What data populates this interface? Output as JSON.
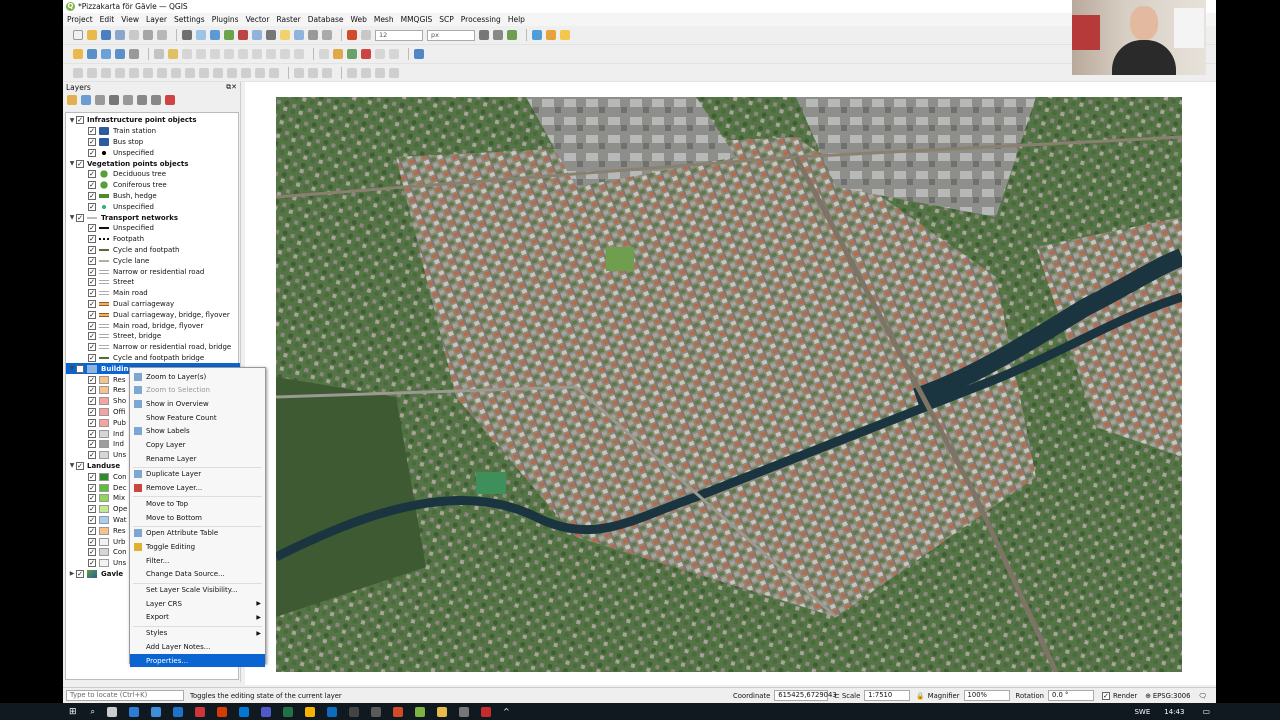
{
  "window": {
    "title": "*Pizzakarta för Gävle — QGIS"
  },
  "menubar": [
    "Project",
    "Edit",
    "View",
    "Layer",
    "Settings",
    "Plugins",
    "Vector",
    "Raster",
    "Database",
    "Web",
    "Mesh",
    "MMQGIS",
    "SCP",
    "Processing",
    "Help"
  ],
  "toolbar": {
    "font_size_value": "12",
    "unit_value": "px"
  },
  "layers_panel": {
    "title": "Layers",
    "rows": [
      {
        "level": 0,
        "expand": "▼",
        "checked": true,
        "label": "Infrastructure point objects",
        "group": true,
        "sym": "none"
      },
      {
        "level": 1,
        "checked": true,
        "label": "Train station",
        "sym": "train"
      },
      {
        "level": 1,
        "checked": true,
        "label": "Bus stop",
        "sym": "bus"
      },
      {
        "level": 1,
        "checked": true,
        "label": "Unspecified",
        "sym": "dot-black"
      },
      {
        "level": 0,
        "expand": "▼",
        "checked": true,
        "label": "Vegetation points objects",
        "group": true,
        "sym": "none"
      },
      {
        "level": 1,
        "checked": true,
        "label": "Deciduous tree",
        "sym": "tree-green"
      },
      {
        "level": 1,
        "checked": true,
        "label": "Coniferous tree",
        "sym": "tree-green"
      },
      {
        "level": 1,
        "checked": true,
        "label": "Bush, hedge",
        "sym": "bush"
      },
      {
        "level": 1,
        "checked": true,
        "label": "Unspecified",
        "sym": "dot-green"
      },
      {
        "level": 0,
        "expand": "▼",
        "checked": true,
        "label": "Transport networks",
        "group": true,
        "sym": "line-group"
      },
      {
        "level": 1,
        "checked": true,
        "label": "Unspecified",
        "sym": "line-black"
      },
      {
        "level": 1,
        "checked": true,
        "label": "Footpath",
        "sym": "line-dash"
      },
      {
        "level": 1,
        "checked": true,
        "label": "Cycle and footpath",
        "sym": "line-olive"
      },
      {
        "level": 1,
        "checked": true,
        "label": "Cycle lane",
        "sym": "line-olive-thin"
      },
      {
        "level": 1,
        "checked": true,
        "label": "Narrow or residential road",
        "sym": "line-white"
      },
      {
        "level": 1,
        "checked": true,
        "label": "Street",
        "sym": "line-white"
      },
      {
        "level": 1,
        "checked": true,
        "label": "Main road",
        "sym": "line-white"
      },
      {
        "level": 1,
        "checked": true,
        "label": "Dual carriageway",
        "sym": "line-orange"
      },
      {
        "level": 1,
        "checked": true,
        "label": "Dual carriageway, bridge, flyover",
        "sym": "line-orange"
      },
      {
        "level": 1,
        "checked": true,
        "label": "Main road, bridge, flyover",
        "sym": "line-white"
      },
      {
        "level": 1,
        "checked": true,
        "label": "Street, bridge",
        "sym": "line-white"
      },
      {
        "level": 1,
        "checked": true,
        "label": "Narrow or residential road, bridge",
        "sym": "line-white"
      },
      {
        "level": 1,
        "checked": true,
        "label": "Cycle and footpath bridge",
        "sym": "line-olive"
      },
      {
        "level": 0,
        "expand": "▼",
        "checked": true,
        "label": "Buildings",
        "group": true,
        "selected": true,
        "sym": "poly-blue"
      },
      {
        "level": 1,
        "checked": true,
        "label": "Res",
        "sym": "sq-peach"
      },
      {
        "level": 1,
        "checked": true,
        "label": "Res",
        "sym": "sq-peach"
      },
      {
        "level": 1,
        "checked": true,
        "label": "Sho",
        "sym": "sq-pink"
      },
      {
        "level": 1,
        "checked": true,
        "label": "Offi",
        "sym": "sq-pink"
      },
      {
        "level": 1,
        "checked": true,
        "label": "Pub",
        "sym": "sq-pink"
      },
      {
        "level": 1,
        "checked": true,
        "label": "Ind",
        "sym": "sq-lgray"
      },
      {
        "level": 1,
        "checked": true,
        "label": "Ind",
        "sym": "sq-gray"
      },
      {
        "level": 1,
        "checked": true,
        "label": "Uns",
        "sym": "sq-lgray"
      },
      {
        "level": 0,
        "expand": "▼",
        "checked": true,
        "label": "Landuse",
        "group": true,
        "sym": "none"
      },
      {
        "level": 1,
        "checked": true,
        "label": "Con",
        "sym": "sq-dgreen"
      },
      {
        "level": 1,
        "checked": true,
        "label": "Dec",
        "sym": "sq-green"
      },
      {
        "level": 1,
        "checked": true,
        "label": "Mix",
        "sym": "sq-lgreen"
      },
      {
        "level": 1,
        "checked": true,
        "label": "Ope",
        "sym": "sq-ygreen"
      },
      {
        "level": 1,
        "checked": true,
        "label": "Wat",
        "sym": "sq-blue"
      },
      {
        "level": 1,
        "checked": true,
        "label": "Res",
        "sym": "sq-peach"
      },
      {
        "level": 1,
        "checked": true,
        "label": "Urb",
        "sym": "sq-white"
      },
      {
        "level": 1,
        "checked": true,
        "label": "Con",
        "sym": "sq-lgray"
      },
      {
        "level": 1,
        "checked": true,
        "label": "Uns",
        "sym": "sq-white"
      },
      {
        "level": 0,
        "expand": "▶",
        "checked": true,
        "label": "Gavle",
        "group": true,
        "sym": "raster"
      }
    ]
  },
  "context_menu": {
    "items": [
      {
        "label": "Zoom to Layer(s)",
        "icon": "zoom-icon"
      },
      {
        "label": "Zoom to Selection",
        "disabled": true,
        "icon": "zoom-selection-icon"
      },
      {
        "label": "Show in Overview",
        "icon": "overview-icon"
      },
      {
        "label": "Show Feature Count"
      },
      {
        "label": "Show Labels",
        "icon": "labels-icon"
      },
      {
        "label": "Copy Layer"
      },
      {
        "label": "Rename Layer"
      },
      {
        "sep": true
      },
      {
        "label": "Duplicate Layer",
        "icon": "duplicate-icon"
      },
      {
        "label": "Remove Layer...",
        "icon": "remove-icon"
      },
      {
        "sep": true
      },
      {
        "label": "Move to Top"
      },
      {
        "label": "Move to Bottom"
      },
      {
        "sep": true
      },
      {
        "label": "Open Attribute Table",
        "icon": "table-icon"
      },
      {
        "label": "Toggle Editing",
        "icon": "pencil-icon"
      },
      {
        "label": "Filter..."
      },
      {
        "label": "Change Data Source..."
      },
      {
        "sep": true
      },
      {
        "label": "Set Layer Scale Visibility..."
      },
      {
        "label": "Layer CRS",
        "submenu": true
      },
      {
        "label": "Export",
        "submenu": true
      },
      {
        "sep": true
      },
      {
        "label": "Styles",
        "submenu": true
      },
      {
        "label": "Add Layer Notes..."
      },
      {
        "label": "Properties...",
        "selected": true
      }
    ]
  },
  "statusbar": {
    "locate_placeholder": "Type to locate (Ctrl+K)",
    "message": "Toggles the editing state of the current layer",
    "coordinate_label": "Coordinate",
    "coordinate_value": "615425,6729043",
    "scale_label": "Scale",
    "scale_value": "1:7510",
    "magnifier_label": "Magnifier",
    "magnifier_value": "100%",
    "rotation_label": "Rotation",
    "rotation_value": "0.0 °",
    "render_label": "Render",
    "crs": "EPSG:3006"
  },
  "taskbar": {
    "language": "SWE",
    "time": "14:43"
  },
  "colors": {
    "selection": "#0a64d2",
    "water": "#1b3540"
  }
}
